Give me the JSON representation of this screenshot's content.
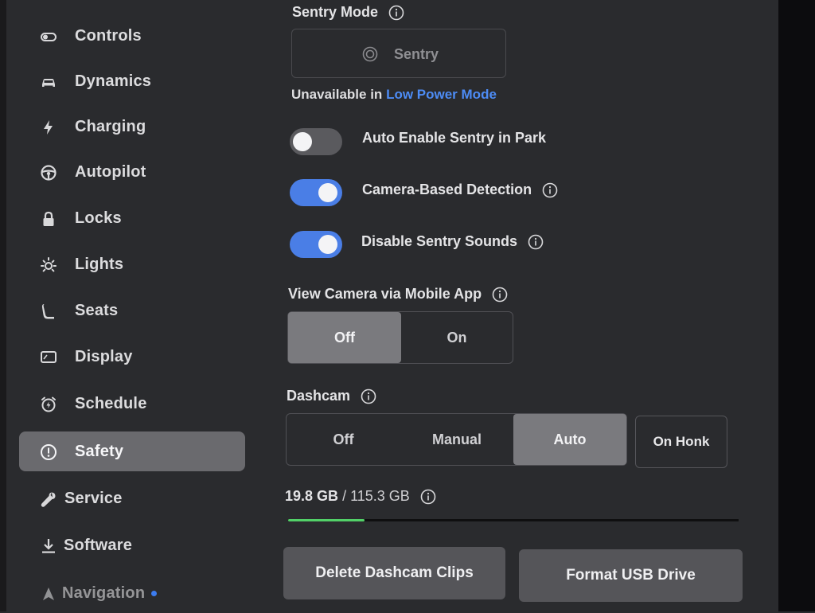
{
  "sidebar": {
    "items": [
      {
        "label": "Controls",
        "icon": "toggle-icon"
      },
      {
        "label": "Dynamics",
        "icon": "car-icon"
      },
      {
        "label": "Charging",
        "icon": "bolt-icon"
      },
      {
        "label": "Autopilot",
        "icon": "steering-wheel-icon"
      },
      {
        "label": "Locks",
        "icon": "lock-icon"
      },
      {
        "label": "Lights",
        "icon": "sun-icon"
      },
      {
        "label": "Seats",
        "icon": "seat-icon"
      },
      {
        "label": "Display",
        "icon": "display-icon"
      },
      {
        "label": "Schedule",
        "icon": "alarm-clock-icon"
      },
      {
        "label": "Safety",
        "icon": "alert-circle-icon",
        "active": true
      },
      {
        "label": "Service",
        "icon": "wrench-icon"
      },
      {
        "label": "Software",
        "icon": "download-icon"
      },
      {
        "label": "Navigation",
        "icon": "navigation-arrow-icon",
        "notification_dot": true
      }
    ]
  },
  "sentry": {
    "heading": "Sentry Mode",
    "button_label": "Sentry",
    "unavailable_prefix": "Unavailable in",
    "unavailable_link": "Low Power Mode"
  },
  "toggles": {
    "auto_enable": {
      "label": "Auto Enable Sentry in Park",
      "on": false
    },
    "camera_detection": {
      "label": "Camera-Based Detection",
      "on": true
    },
    "disable_sounds": {
      "label": "Disable Sentry Sounds",
      "on": true
    }
  },
  "view_camera": {
    "heading": "View Camera via Mobile App",
    "options": [
      "Off",
      "On"
    ],
    "selected": "Off"
  },
  "dashcam": {
    "heading": "Dashcam",
    "options": [
      "Off",
      "Manual",
      "Auto"
    ],
    "selected": "Auto",
    "on_honk_label": "On Honk"
  },
  "storage": {
    "used": "19.8 GB",
    "total": "/ 115.3 GB",
    "fill_fraction": 0.17
  },
  "actions": {
    "delete_label": "Delete Dashcam Clips",
    "format_label": "Format USB Drive"
  },
  "colors": {
    "accent_blue": "#4a7ee6",
    "link_blue": "#4d8cf5",
    "storage_green": "#52d168",
    "notification_dot": "#3c7cf0"
  }
}
